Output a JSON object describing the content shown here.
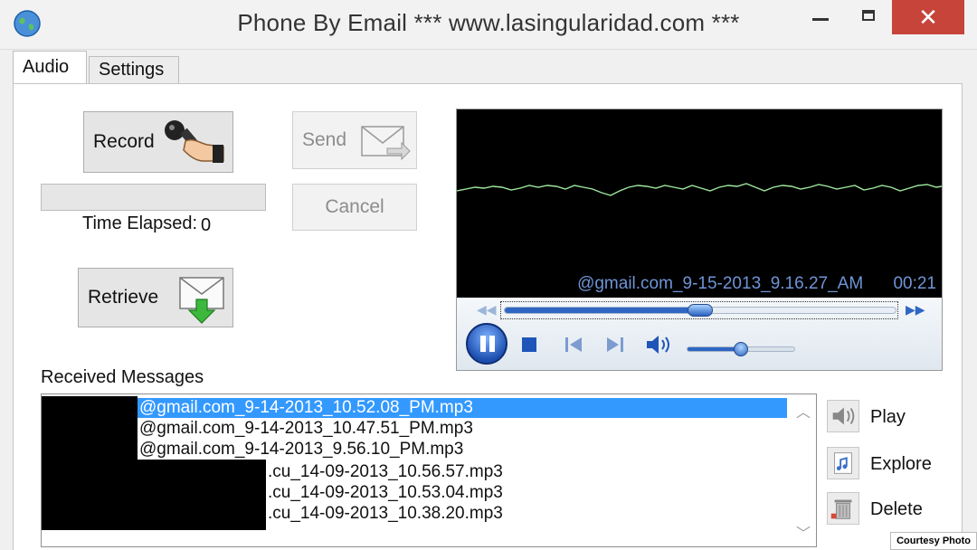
{
  "window": {
    "title": "Phone By Email *** www.lasingularidad.com  ***",
    "close_glyph": "✕"
  },
  "tabs": [
    {
      "label": "Audio",
      "active": true
    },
    {
      "label": "Settings",
      "active": false
    }
  ],
  "audio": {
    "record_label": "Record",
    "send_label": "Send",
    "cancel_label": "Cancel",
    "retrieve_label": "Retrieve",
    "progress_fraction": 0,
    "time_elapsed_label": "Time Elapsed:",
    "time_elapsed_value": "0"
  },
  "player": {
    "media_name": "@gmail.com_9-15-2013_9.16.27_AM",
    "time": "00:21",
    "seek_fraction": 0.5,
    "volume_fraction": 0.5,
    "state": "playing",
    "seek_back_glyph": "◀◀",
    "seek_fwd_glyph": "▶▶",
    "colors": {
      "background": "#000000",
      "waveform": "#9ee89e",
      "text": "#6f94d6"
    }
  },
  "messages": {
    "label": "Received Messages",
    "items": [
      {
        "text": "@gmail.com_9-14-2013_10.52.08_PM.mp3",
        "selected": true
      },
      {
        "text": "@gmail.com_9-14-2013_10.47.51_PM.mp3",
        "selected": false
      },
      {
        "text": "@gmail.com_9-14-2013_9.56.10_PM.mp3",
        "selected": false
      },
      {
        "text": ".cu_14-09-2013_10.56.57.mp3",
        "selected": false
      },
      {
        "text": ".cu_14-09-2013_10.53.04.mp3",
        "selected": false
      },
      {
        "text": ".cu_14-09-2013_10.38.20.mp3",
        "selected": false
      }
    ],
    "scroll_up_glyph": "︿",
    "scroll_down_glyph": "﹀"
  },
  "actions": {
    "play_label": "Play",
    "explore_label": "Explore",
    "delete_label": "Delete"
  },
  "icons": {
    "app": "globe-icon",
    "record": "microphone-hand-icon",
    "send": "envelope-arrow-icon",
    "retrieve": "envelope-download-icon",
    "play": "speaker-icon",
    "explore": "folder-audio-icon",
    "delete": "trash-icon"
  },
  "credit": "Courtesy Photo",
  "colors": {
    "selection": "#3399ff",
    "close_button": "#c7443b",
    "accent": "#2f66c4"
  }
}
